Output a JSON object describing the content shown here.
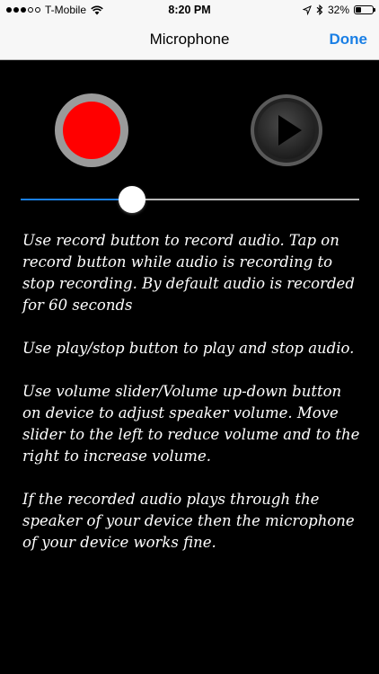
{
  "status_bar": {
    "carrier": "T-Mobile",
    "time": "8:20 PM",
    "battery": "32%",
    "battery_level": 0.32
  },
  "navbar": {
    "title": "Microphone",
    "done_label": "Done"
  },
  "controls": {
    "record_color": "#ff0000",
    "volume_level": 0.33
  },
  "instructions": [
    "Use record button to record audio. Tap on record button while audio is recording to stop recording. By default audio is recorded for 60 seconds",
    "Use play/stop button to play and stop audio.",
    "Use volume slider/Volume up-down button on device to adjust speaker volume. Move slider to the left to reduce volume and to the right to increase volume.",
    "If the recorded audio plays through the speaker of your device then the microphone of your device works fine."
  ],
  "colors": {
    "accent": "#1a7fe5",
    "background": "#000000"
  }
}
